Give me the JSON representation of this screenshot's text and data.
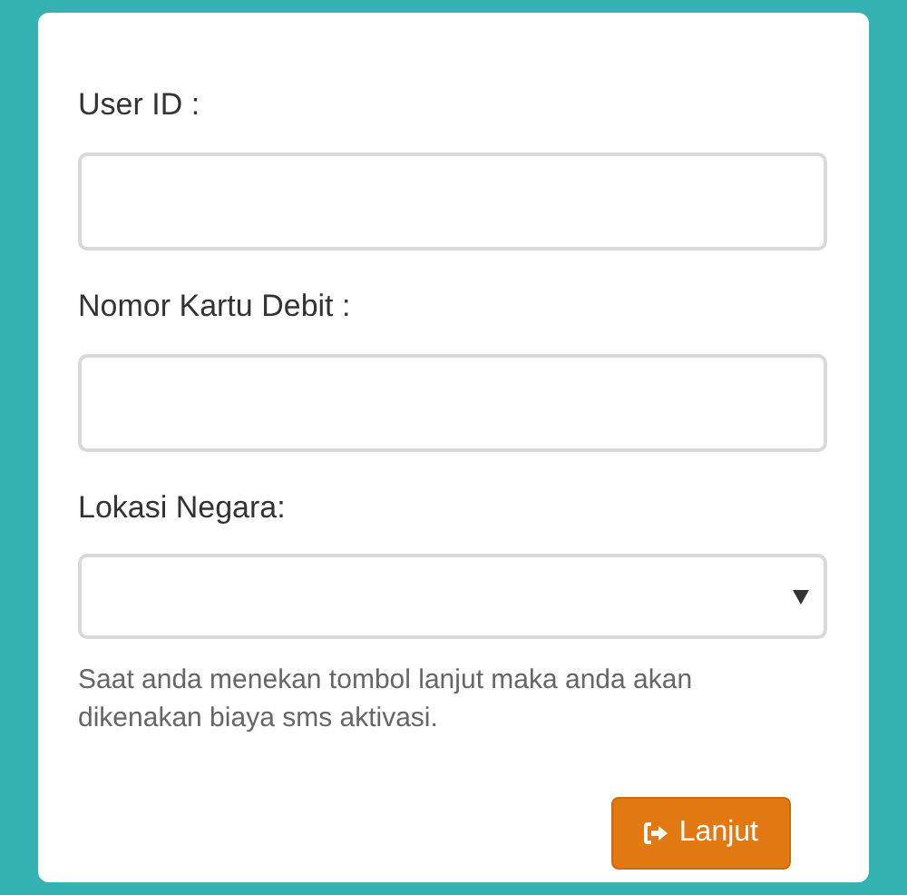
{
  "fields": [
    {
      "kind": "input",
      "label": "User ID :"
    },
    {
      "kind": "input",
      "label": "Nomor Kartu Debit :"
    },
    {
      "kind": "select",
      "label": "Lokasi Negara:"
    }
  ],
  "notice": "Saat anda menekan tombol lanjut maka anda akan dikenakan biaya sms aktivasi.",
  "submit_button": "Lanjut"
}
